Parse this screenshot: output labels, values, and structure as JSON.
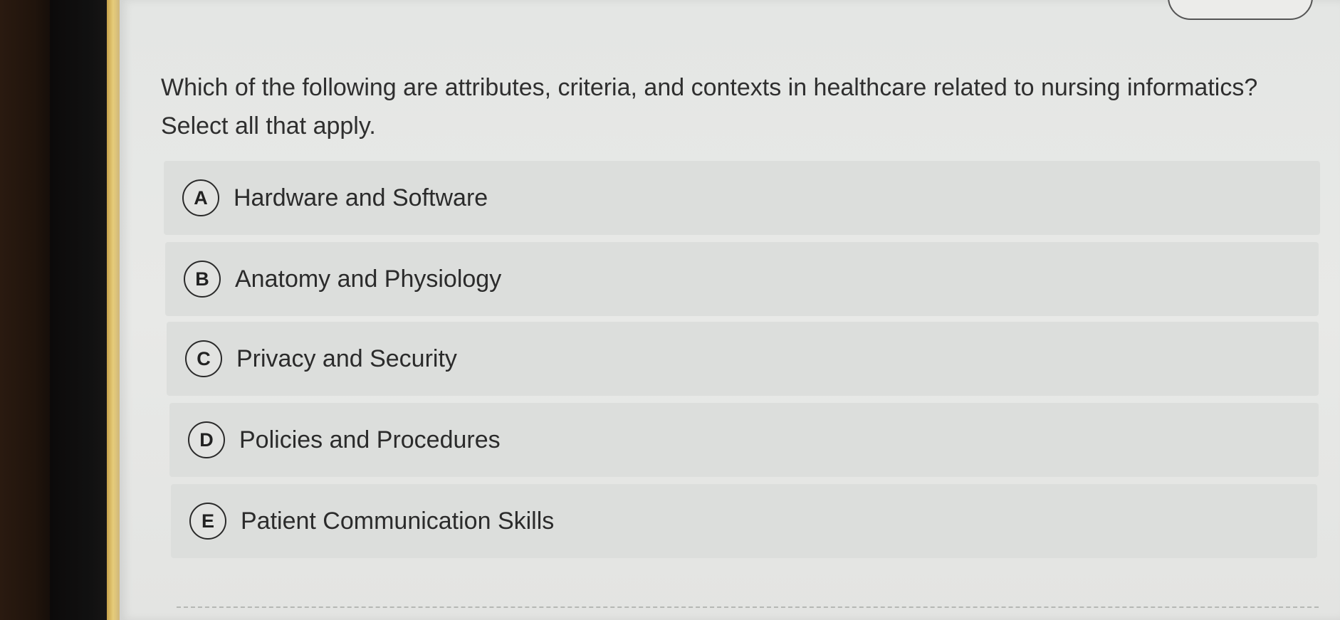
{
  "question": {
    "line1": "Which of the following are attributes, criteria, and contexts in healthcare related to nursing informatics?",
    "line2": "Select all that apply."
  },
  "options": [
    {
      "letter": "A",
      "label": "Hardware and Software"
    },
    {
      "letter": "B",
      "label": "Anatomy and Physiology"
    },
    {
      "letter": "C",
      "label": "Privacy and Security"
    },
    {
      "letter": "D",
      "label": "Policies and Procedures"
    },
    {
      "letter": "E",
      "label": "Patient Communication Skills"
    }
  ],
  "colors": {
    "screen_bg": "#e6e7e5",
    "option_bg": "#dcdedc",
    "text": "#2f2f2f",
    "accent_strip": "#e6cc7a"
  }
}
